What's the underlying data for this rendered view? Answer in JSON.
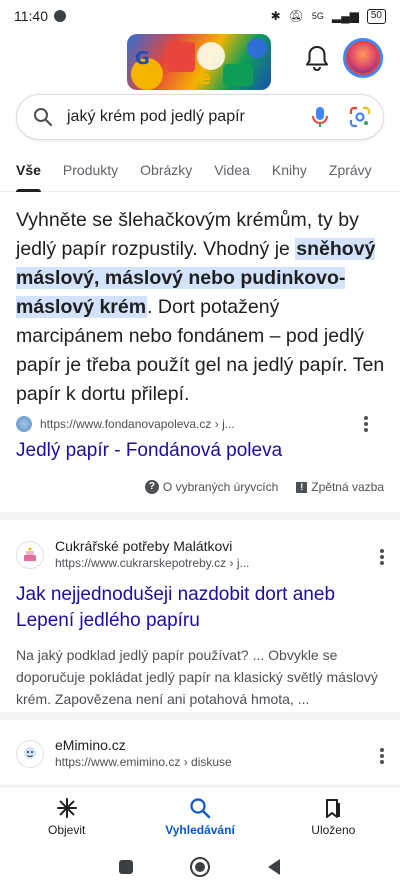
{
  "status_bar": {
    "time": "11:40",
    "network": "5G",
    "battery": "50"
  },
  "search": {
    "query": "jaký krém pod jedlý papír"
  },
  "tabs": [
    {
      "label": "Vše",
      "active": true
    },
    {
      "label": "Produkty",
      "active": false
    },
    {
      "label": "Obrázky",
      "active": false
    },
    {
      "label": "Videa",
      "active": false
    },
    {
      "label": "Knihy",
      "active": false
    },
    {
      "label": "Zprávy",
      "active": false
    }
  ],
  "featured": {
    "text_before": "Vyhněte se šlehačkovým krémům, ty by jedlý papír rozpustily. Vhodný je ",
    "highlight": "sněhový máslový, máslový nebo pudinkovo-máslový krém",
    "text_after": ". Dort potažený marcipánem nebo fondánem – pod jedlý papír je třeba použít gel na jedlý papír. Ten papír k dortu přilepí.",
    "source_url": "https://www.fondanovapoleva.cz › j...",
    "source_title": "Jedlý papír - Fondánová poleva",
    "about_label": "O vybraných úryvcích",
    "feedback_label": "Zpětná vazba"
  },
  "results": [
    {
      "site": "Cukrářské potřeby Malátkovi",
      "url": "https://www.cukrarskepotreby.cz › j...",
      "title": "Jak nejjednodušeji nazdobit dort aneb Lepení jedlého papíru",
      "description": "Na jaký podklad jedlý papír používat? ... Obvykle se doporučuje pokládat jedlý papír na klasický světlý máslový krém. Zapovězena není ani potahová hmota, ..."
    },
    {
      "site": "eMimino.cz",
      "url": "https://www.emimino.cz › diskuse"
    }
  ],
  "bottom_nav": [
    {
      "label": "Objevit",
      "icon": "asterisk-icon",
      "active": false
    },
    {
      "label": "Vyhledávání",
      "icon": "search-icon",
      "active": true
    },
    {
      "label": "Uloženo",
      "icon": "bookmark-icon",
      "active": false
    }
  ],
  "colors": {
    "link": "#1a0dab",
    "highlight": "#d3e3fd",
    "accent": "#0b57d0"
  }
}
